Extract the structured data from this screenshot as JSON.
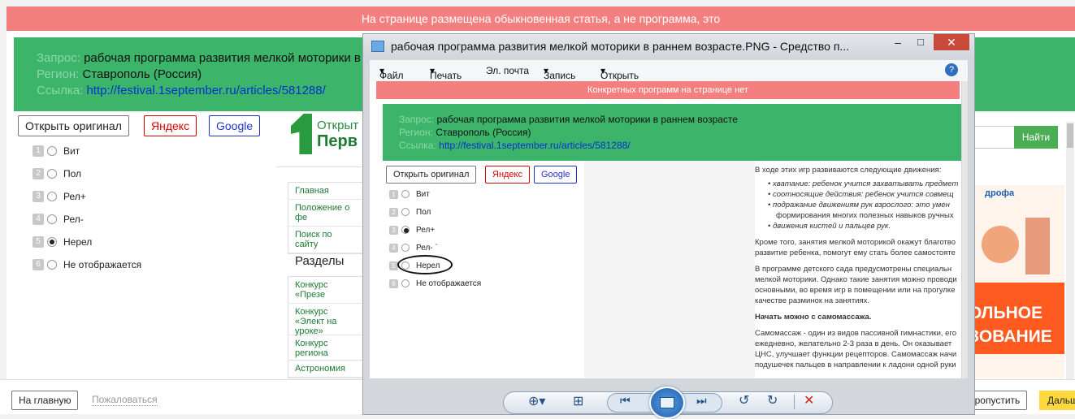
{
  "banner": {
    "text": "На странице размещена обыкновенная статья, а не программа, это"
  },
  "query": {
    "label_query": "Запрос:",
    "query": "рабочая программа развития мелкой моторики в раннем возрасте",
    "label_region": "Регион:",
    "region": "Ставрополь (Россия)",
    "label_link": "Ссылка:",
    "link": "http://festival.1september.ru/articles/581288/"
  },
  "buttons": {
    "open_original": "Открыть оригинал",
    "yandex": "Яндекс",
    "google": "Google"
  },
  "options": [
    {
      "num": "1",
      "label": "Вит",
      "checked": false
    },
    {
      "num": "2",
      "label": "Пол",
      "checked": false
    },
    {
      "num": "3",
      "label": "Рел+",
      "checked": false
    },
    {
      "num": "4",
      "label": "Рел-",
      "checked": false
    },
    {
      "num": "5",
      "label": "Нерел",
      "checked": true
    },
    {
      "num": "6",
      "label": "Не отображается",
      "checked": false
    }
  ],
  "site": {
    "logo_top": "Открыт",
    "logo_bottom": "Перв",
    "nav": [
      "Главная",
      "Положение о фе",
      "Поиск по сайту"
    ],
    "sections_title": "Разделы",
    "sections": [
      "Конкурс «Презе",
      "Конкурс «Элект на уроке»",
      "Конкурс региона"
    ],
    "extra": [
      "Астрономия"
    ],
    "search_button": "Найти",
    "ad_text_1": "ОЛЬНОЕ",
    "ad_text_2": "ЗОВАНИЕ",
    "ad_brand": "дрофа"
  },
  "bottom": {
    "home": "На главную",
    "complain": "Пожаловаться",
    "skip": "Пропустить",
    "next": "Дальш"
  },
  "viewer": {
    "title": "рабочая программа развития мелкой моторики в раннем возрасте.PNG - Средство п...",
    "menu": [
      "Файл",
      "Печать",
      "Эл. почта",
      "Запись",
      "Открыть"
    ],
    "inner_banner": "Конкретных программ на странице нет",
    "inner_options": [
      {
        "num": "1",
        "label": "Вит",
        "checked": false
      },
      {
        "num": "2",
        "label": "Пол",
        "checked": false
      },
      {
        "num": "3",
        "label": "Рел+",
        "checked": true
      },
      {
        "num": "4",
        "label": "Рел- `",
        "checked": false
      },
      {
        "num": "5",
        "label": "Нерел",
        "checked": false
      },
      {
        "num": "6",
        "label": "Не отображается",
        "checked": false
      }
    ],
    "article": {
      "p1": "В ходе этих игр развиваются следующие движения:",
      "b1": "хватание: ребенок учится захватывать предмет",
      "b2": "соотносящие действия: ребенок учится совмещ",
      "b3a": "подражание движениям рук взрослого: это умен",
      "b3b": "формирования многих полезных навыков ручных",
      "b4": "движения кистей и пальцев рук.",
      "p2a": "Кроме того, занятия мелкой моторикой окажут благотво",
      "p2b": "развитие ребенка, помогут ему стать более самостояте",
      "p3a": "В программе детского сада предусмотрены специальн",
      "p3b": "мелкой моторики. Однако такие занятия можно проводи",
      "p3c": "основными, во время игр в помещении или на прогулке",
      "p3d": "качестве разминок на занятиях.",
      "h1": "Начать можно с самомассажа.",
      "p4a": "Самомассаж - один из видов пассивной гимнастики, его",
      "p4b": "ежедневно, желательно 2-3 раза в день. Он оказывает",
      "p4c": "ЦНС, улучшает функции рецепторов. Самомассаж начи",
      "p4d": "подушечек пальцев в направлении к ладони одной руки"
    }
  },
  "colors": {
    "banner": "#f47f7f",
    "green": "#3cb56b",
    "accent_yellow": "#ffd83d"
  }
}
